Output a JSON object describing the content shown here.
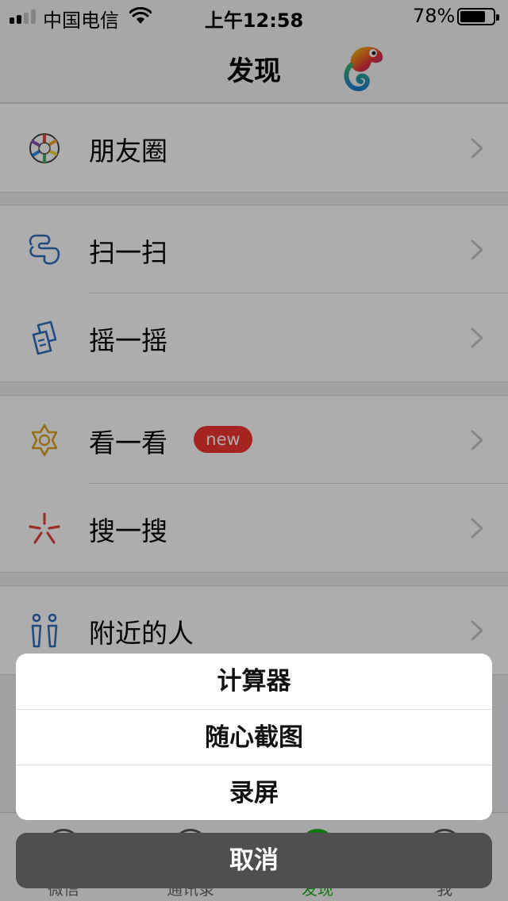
{
  "status_bar": {
    "carrier": "中国电信",
    "time": "上午12:58",
    "battery_percent": "78%",
    "battery_level": 0.78,
    "signal_bars_filled": 2,
    "signal_bars_total": 4
  },
  "nav": {
    "title": "发现",
    "logo_icon": "chameleon-icon"
  },
  "list_groups": [
    {
      "items": [
        {
          "label": "朋友圈",
          "icon": "moments-icon"
        }
      ]
    },
    {
      "items": [
        {
          "label": "扫一扫",
          "icon": "scan-icon"
        },
        {
          "label": "摇一摇",
          "icon": "shake-icon"
        }
      ]
    },
    {
      "items": [
        {
          "label": "看一看",
          "icon": "top-stories-icon",
          "badge": "new"
        },
        {
          "label": "搜一搜",
          "icon": "search-icon"
        }
      ]
    },
    {
      "items": [
        {
          "label": "附近的人",
          "icon": "people-nearby-icon"
        }
      ]
    }
  ],
  "tab_bar": {
    "tabs": [
      {
        "label": "微信",
        "icon": "chats-icon"
      },
      {
        "label": "通讯录",
        "icon": "contacts-icon"
      },
      {
        "label": "发现",
        "icon": "discover-icon",
        "active": true
      },
      {
        "label": "我",
        "icon": "me-icon"
      }
    ]
  },
  "action_sheet": {
    "items": [
      "计算器",
      "随心截图",
      "录屏"
    ],
    "cancel": "取消"
  },
  "colors": {
    "accent_green": "#1aad19",
    "badge_red": "#f43530",
    "scan_blue": "#2f6fbf",
    "top_stories_gold": "#e1a326",
    "search_red": "#e0463d"
  }
}
